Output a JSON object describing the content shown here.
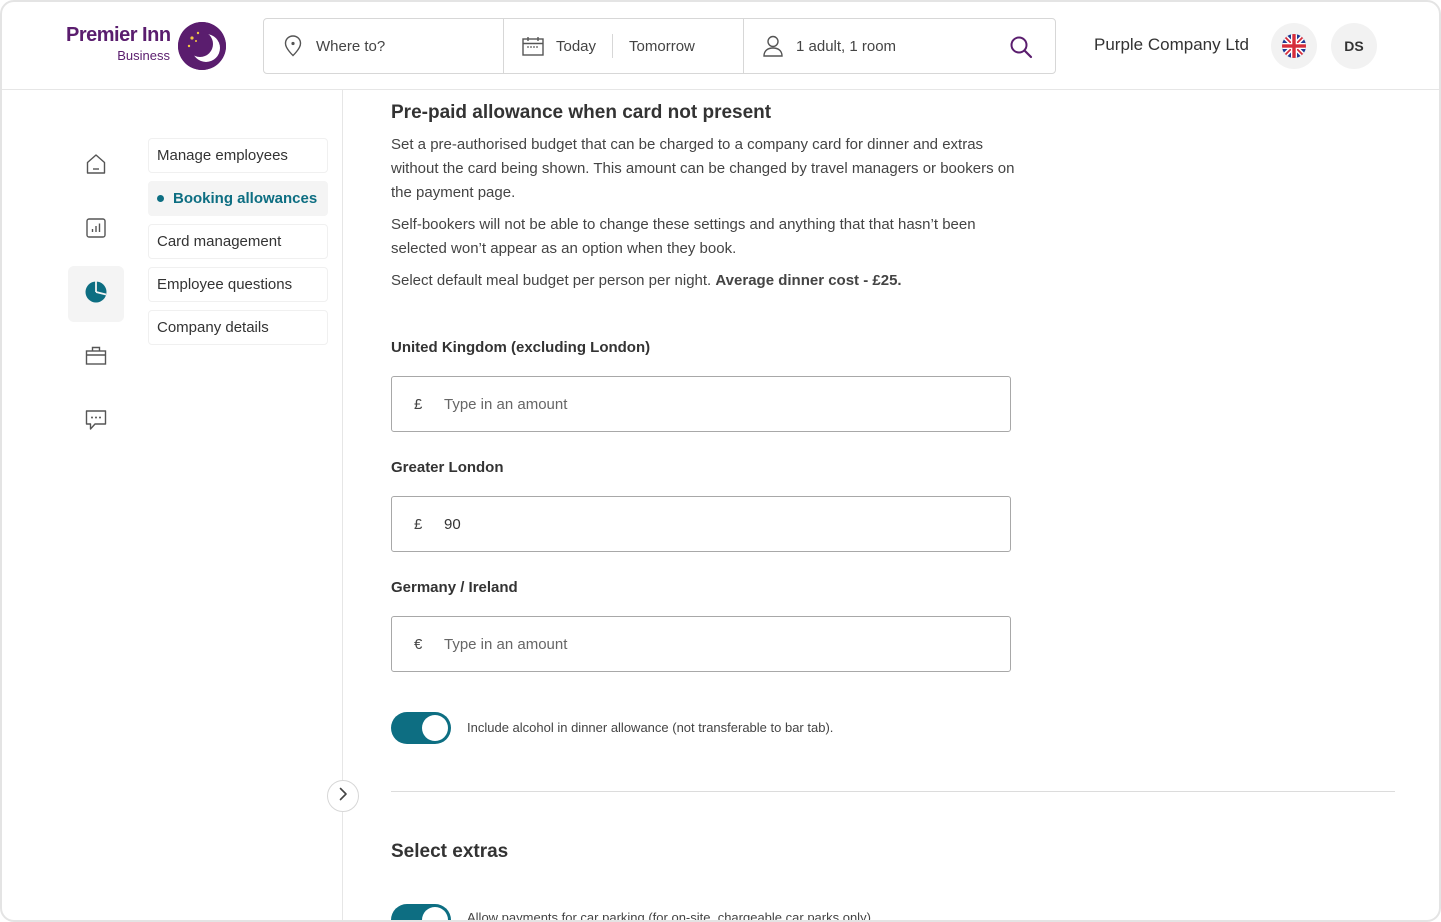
{
  "brand": {
    "name": "Premier Inn",
    "sub": "Business"
  },
  "search": {
    "where_placeholder": "Where to?",
    "checkin": "Today",
    "checkout": "Tomorrow",
    "guests": "1 adult, 1 room"
  },
  "account": {
    "company": "Purple Company Ltd",
    "initials": "DS",
    "language_flag": "uk-flag-icon"
  },
  "rail": [
    {
      "icon": "home-icon"
    },
    {
      "icon": "chart-icon"
    },
    {
      "icon": "pie-chart-icon",
      "active": true
    },
    {
      "icon": "briefcase-icon"
    },
    {
      "icon": "chat-icon"
    }
  ],
  "submenu": {
    "items": [
      "Manage employees",
      "Booking allowances",
      "Card management",
      "Employee questions",
      "Company details"
    ],
    "active_index": 1
  },
  "content": {
    "title": "Pre-paid allowance when card not present",
    "para1": "Set a pre-authorised budget that can be charged to a company card for dinner and extras without the card being shown. This amount can be changed by travel managers or bookers on the payment page.",
    "para2": "Self-bookers will not be able to change these settings and anything that that hasn’t been selected won’t appear as an option when they book.",
    "para3_lead": "Select default meal budget per person per night.",
    "para3_bold": "Average dinner cost - £25.",
    "fields": [
      {
        "label": "United Kingdom (excluding London)",
        "currency": "£",
        "value": "",
        "placeholder": "Type in an amount"
      },
      {
        "label": "Greater London",
        "currency": "£",
        "value": "90",
        "placeholder": ""
      },
      {
        "label": "Germany / Ireland",
        "currency": "€",
        "value": "",
        "placeholder": "Type in an amount"
      }
    ],
    "alcohol_toggle": {
      "label": "Include alcohol in dinner allowance (not transferable to bar tab).",
      "on": true
    },
    "extras_title": "Select extras",
    "parking_toggle": {
      "label": "Allow payments for car parking (for on-site, chargeable car parks only)",
      "on": true
    }
  },
  "colors": {
    "brand_purple": "#5a1d6e",
    "accent_teal": "#0d6e82"
  }
}
